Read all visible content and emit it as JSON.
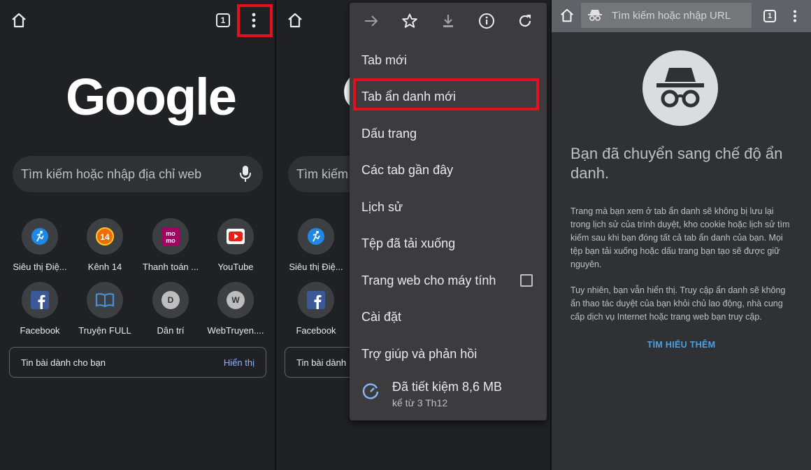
{
  "panel1": {
    "tab_count": "1",
    "logo": "Google",
    "search_placeholder": "Tìm kiếm hoặc nhập địa chỉ web",
    "tiles": [
      {
        "label": "Siêu thị Điệ...",
        "icon": "running-man-icon"
      },
      {
        "label": "Kênh 14",
        "icon": "kenh14-logo-icon"
      },
      {
        "label": "Thanh toán ...",
        "icon": "momo-logo-icon"
      },
      {
        "label": "YouTube",
        "icon": "youtube-logo-icon"
      },
      {
        "label": "Facebook",
        "icon": "facebook-logo-icon"
      },
      {
        "label": "Truyện FULL",
        "icon": "book-icon"
      },
      {
        "label": "Dân trí",
        "icon": "letter-d-icon",
        "letter": "D"
      },
      {
        "label": "WebTruyen....",
        "icon": "letter-w-icon",
        "letter": "W"
      }
    ],
    "feed_label": "Tin bài dành cho bạn",
    "feed_action": "Hiển thị"
  },
  "panel2": {
    "search_placeholder": "Tìm kiếm",
    "tiles": [
      {
        "label": "Siêu thị Điệ..."
      },
      {
        "label": "Facebook"
      }
    ],
    "feed_label": "Tin bài dành",
    "menu": {
      "top_icons": [
        "forward-arrow-icon",
        "star-icon",
        "download-icon",
        "info-icon",
        "reload-icon"
      ],
      "items": [
        "Tab mới",
        "Tab ẩn danh mới",
        "Dấu trang",
        "Các tab gần đây",
        "Lịch sử",
        "Tệp đã tải xuống",
        "Trang web cho máy tính",
        "Cài đặt",
        "Trợ giúp và phản hồi"
      ],
      "highlighted_item": "Tab ẩn danh mới",
      "savings_title": "Đã tiết kiệm 8,6 MB",
      "savings_sub": "kể từ 3 Th12"
    }
  },
  "panel3": {
    "url_placeholder": "Tìm kiếm hoặc nhập URL",
    "tab_count": "1",
    "title": "Bạn đã chuyển sang chế độ ẩn danh.",
    "para1": "Trang mà bạn xem ở tab ẩn danh sẽ không bị lưu lại trong lịch sử của trình duyệt, kho cookie hoặc lịch sử tìm kiếm sau khi bạn đóng tất cả tab ẩn danh của bạn. Mọi tệp bạn tải xuống hoặc dấu trang bạn tạo sẽ được giữ nguyên.",
    "para2": "Tuy nhiên, bạn vẫn hiển thị. Truy cập ẩn danh sẽ không ẩn thao tác duyệt của bạn khỏi chủ lao động, nhà cung cấp dịch vụ Internet hoặc trang web bạn truy cập.",
    "learn_more": "TÌM HIỂU THÊM"
  },
  "colors": {
    "background": "#202124",
    "highlight": "#e4101b",
    "link": "#8ab4f8",
    "incognito_link": "#4fa0dc"
  }
}
